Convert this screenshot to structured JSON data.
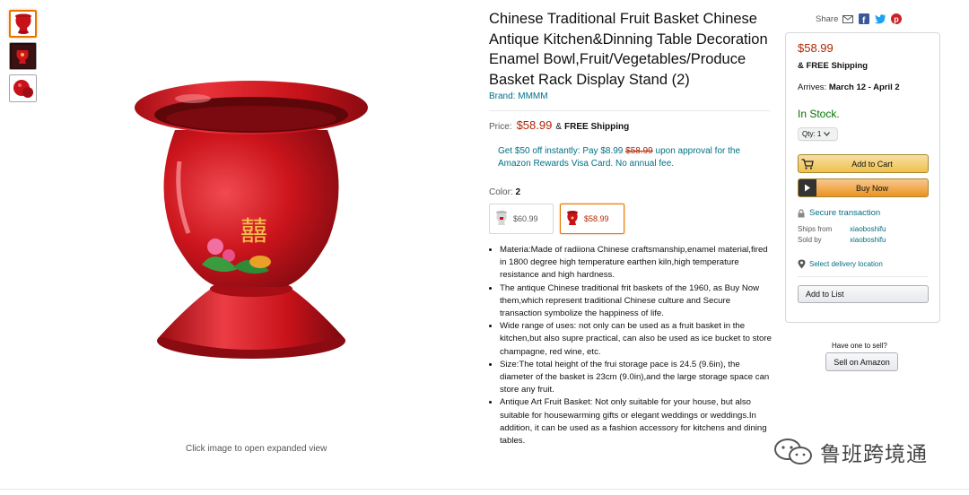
{
  "thumbnails": [
    {
      "icon": "red-vase-thumbnail",
      "active": true
    },
    {
      "icon": "red-vase-lifestyle-thumbnail",
      "active": false
    },
    {
      "icon": "red-vase-detail-thumbnail",
      "active": false
    }
  ],
  "main_image": {
    "icon": "red-enamel-fruit-basket-image",
    "caption": "Click image to open expanded view"
  },
  "product": {
    "title": "Chinese Traditional Fruit Basket Chinese Antique Kitchen&Dinning Table Decoration Enamel Bowl,Fruit/Vegetables/Produce Basket Rack Display Stand (2)",
    "brand": "Brand: MMMM",
    "price_label": "Price:",
    "price": "$58.99",
    "free_shipping_amp": "&",
    "free_shipping": "FREE Shipping",
    "promo_prefix": "Get $50 off instantly: Pay $8.99",
    "promo_strike": "$58.99",
    "promo_suffix": "upon approval for the Amazon Rewards Visa Card. No annual fee.",
    "color_label": "Color:",
    "color_value": "2",
    "swatches": [
      {
        "price": "$60.99",
        "selected": false
      },
      {
        "price": "$58.99",
        "selected": true
      }
    ],
    "bullets": [
      "Materia:Made of radiiona Chinese craftsmanship,enamel material,fired in 1800 degree high temperature earthen kiln,high temperature resistance and high hardness.",
      "The antique Chinese traditional frit baskets of the 1960, as Buy Now them,which represent traditional Chinese culture and Secure transaction symbolize the happiness of life.",
      "Wide range of uses: not only can be used as a fruit basket in the kitchen,but also supre practical, can also be used as ice bucket to store champagne, red wine, etc.",
      "Size:The total height of the frui storage pace is 24.5 (9.6in), the diameter of the basket is 23cm (9.0in),and the large storage space can store any fruit.",
      "Antique Art Fruit Basket: Not only suitable for your house, but also suitable for housewarming gifts or elegant weddings or weddings.In addition, it can be used as a fashion accessory for kitchens and dining tables."
    ]
  },
  "share": {
    "label": "Share",
    "icons": [
      "email-icon",
      "facebook-icon",
      "twitter-icon",
      "pinterest-icon"
    ]
  },
  "buybox": {
    "price": "$58.99",
    "shipping": "& FREE Shipping",
    "arrives_label": "Arrives:",
    "arrives_dates": "March 12 - April 2",
    "stock": "In Stock.",
    "qty": "Qty: 1",
    "add_to_cart": "Add to Cart",
    "buy_now": "Buy Now",
    "secure": "Secure transaction",
    "ships_from_label": "Ships from",
    "ships_from": "xiaoboshifu",
    "sold_by_label": "Sold by",
    "sold_by": "xiaoboshifu",
    "delivery_location": "Select delivery location",
    "add_to_list": "Add to List"
  },
  "sell": {
    "question": "Have one to sell?",
    "button": "Sell on Amazon"
  },
  "watermark": "鲁班跨境通",
  "colors": {
    "price": "#b12704",
    "link": "#007185",
    "stock": "#007600",
    "accent": "#e77600",
    "vase_red": "#c8121a"
  }
}
